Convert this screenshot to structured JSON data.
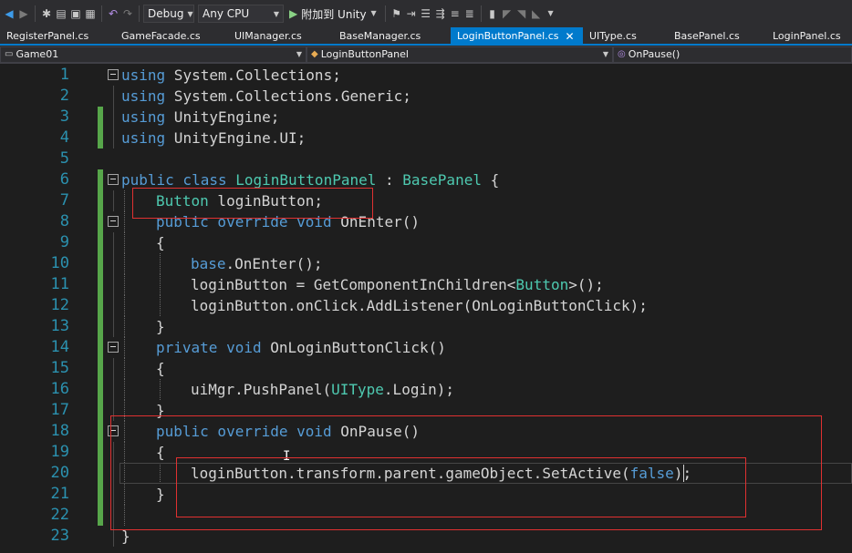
{
  "toolbar": {
    "config": "Debug",
    "platform": "Any CPU",
    "run_label": "附加到 Unity"
  },
  "tabs": [
    {
      "label": "RegisterPanel.cs"
    },
    {
      "label": "GameFacade.cs"
    },
    {
      "label": "UIManager.cs"
    },
    {
      "label": "BaseManager.cs"
    },
    {
      "label": "LoginButtonPanel.cs",
      "active": true,
      "close": "✕"
    },
    {
      "label": "UIType.cs"
    },
    {
      "label": "BasePanel.cs"
    },
    {
      "label": "LoginPanel.cs"
    }
  ],
  "navbar": {
    "project": "Game01",
    "class": "LoginButtonPanel",
    "member": "OnPause()"
  },
  "editor": {
    "line_numbers": [
      "1",
      "2",
      "3",
      "4",
      "5",
      "6",
      "7",
      "8",
      "9",
      "10",
      "11",
      "12",
      "13",
      "14",
      "15",
      "16",
      "17",
      "18",
      "19",
      "20",
      "21",
      "22",
      "23"
    ],
    "lines": [
      [
        {
          "t": "using",
          "c": "kw"
        },
        {
          "t": " System.Collections;",
          "c": "pl"
        }
      ],
      [
        {
          "t": "using",
          "c": "kw"
        },
        {
          "t": " System.Collections.Generic;",
          "c": "pl"
        }
      ],
      [
        {
          "t": "using",
          "c": "kw"
        },
        {
          "t": " UnityEngine;",
          "c": "pl"
        }
      ],
      [
        {
          "t": "using",
          "c": "kw"
        },
        {
          "t": " UnityEngine.UI;",
          "c": "pl"
        }
      ],
      [],
      [
        {
          "t": "public class ",
          "c": "kw"
        },
        {
          "t": "LoginButtonPanel",
          "c": "ty"
        },
        {
          "t": " : ",
          "c": "pl"
        },
        {
          "t": "BasePanel",
          "c": "ty"
        },
        {
          "t": " {",
          "c": "pl"
        }
      ],
      [
        {
          "t": "Button",
          "c": "ty"
        },
        {
          "t": " loginButton;",
          "c": "pl"
        }
      ],
      [
        {
          "t": "public override void",
          "c": "kw"
        },
        {
          "t": " OnEnter()",
          "c": "pl"
        }
      ],
      [
        {
          "t": "{",
          "c": "pl"
        }
      ],
      [
        {
          "t": "base",
          "c": "kw"
        },
        {
          "t": ".OnEnter();",
          "c": "pl"
        }
      ],
      [
        {
          "t": "loginButton = GetComponentInChildren<",
          "c": "pl"
        },
        {
          "t": "Button",
          "c": "ty"
        },
        {
          "t": ">();",
          "c": "pl"
        }
      ],
      [
        {
          "t": "loginButton.onClick.AddListener(OnLoginButtonClick);",
          "c": "pl"
        }
      ],
      [
        {
          "t": "}",
          "c": "pl"
        }
      ],
      [
        {
          "t": "private void",
          "c": "kw"
        },
        {
          "t": " OnLoginButtonClick()",
          "c": "pl"
        }
      ],
      [
        {
          "t": "{",
          "c": "pl"
        }
      ],
      [
        {
          "t": "uiMgr.PushPanel(",
          "c": "pl"
        },
        {
          "t": "UIType",
          "c": "ty"
        },
        {
          "t": ".Login);",
          "c": "pl"
        }
      ],
      [
        {
          "t": "}",
          "c": "pl"
        }
      ],
      [
        {
          "t": "public override void",
          "c": "kw"
        },
        {
          "t": " OnPause()",
          "c": "pl"
        }
      ],
      [
        {
          "t": "{",
          "c": "pl"
        }
      ],
      [
        {
          "t": "loginButton.transform.parent.gameObject.SetActive(",
          "c": "pl"
        },
        {
          "t": "false",
          "c": "kw"
        },
        {
          "t": ");",
          "c": "pl"
        }
      ],
      [
        {
          "t": "}",
          "c": "pl"
        }
      ],
      [],
      [
        {
          "t": "}",
          "c": "pl"
        }
      ]
    ]
  },
  "colors": {
    "keyword": "#569cd6",
    "type": "#4ec9b0",
    "text": "#d4d4d4",
    "line_number": "#2b91af",
    "change_bar": "#57a64a",
    "accent": "#007acc",
    "annotation": "#e03131"
  }
}
